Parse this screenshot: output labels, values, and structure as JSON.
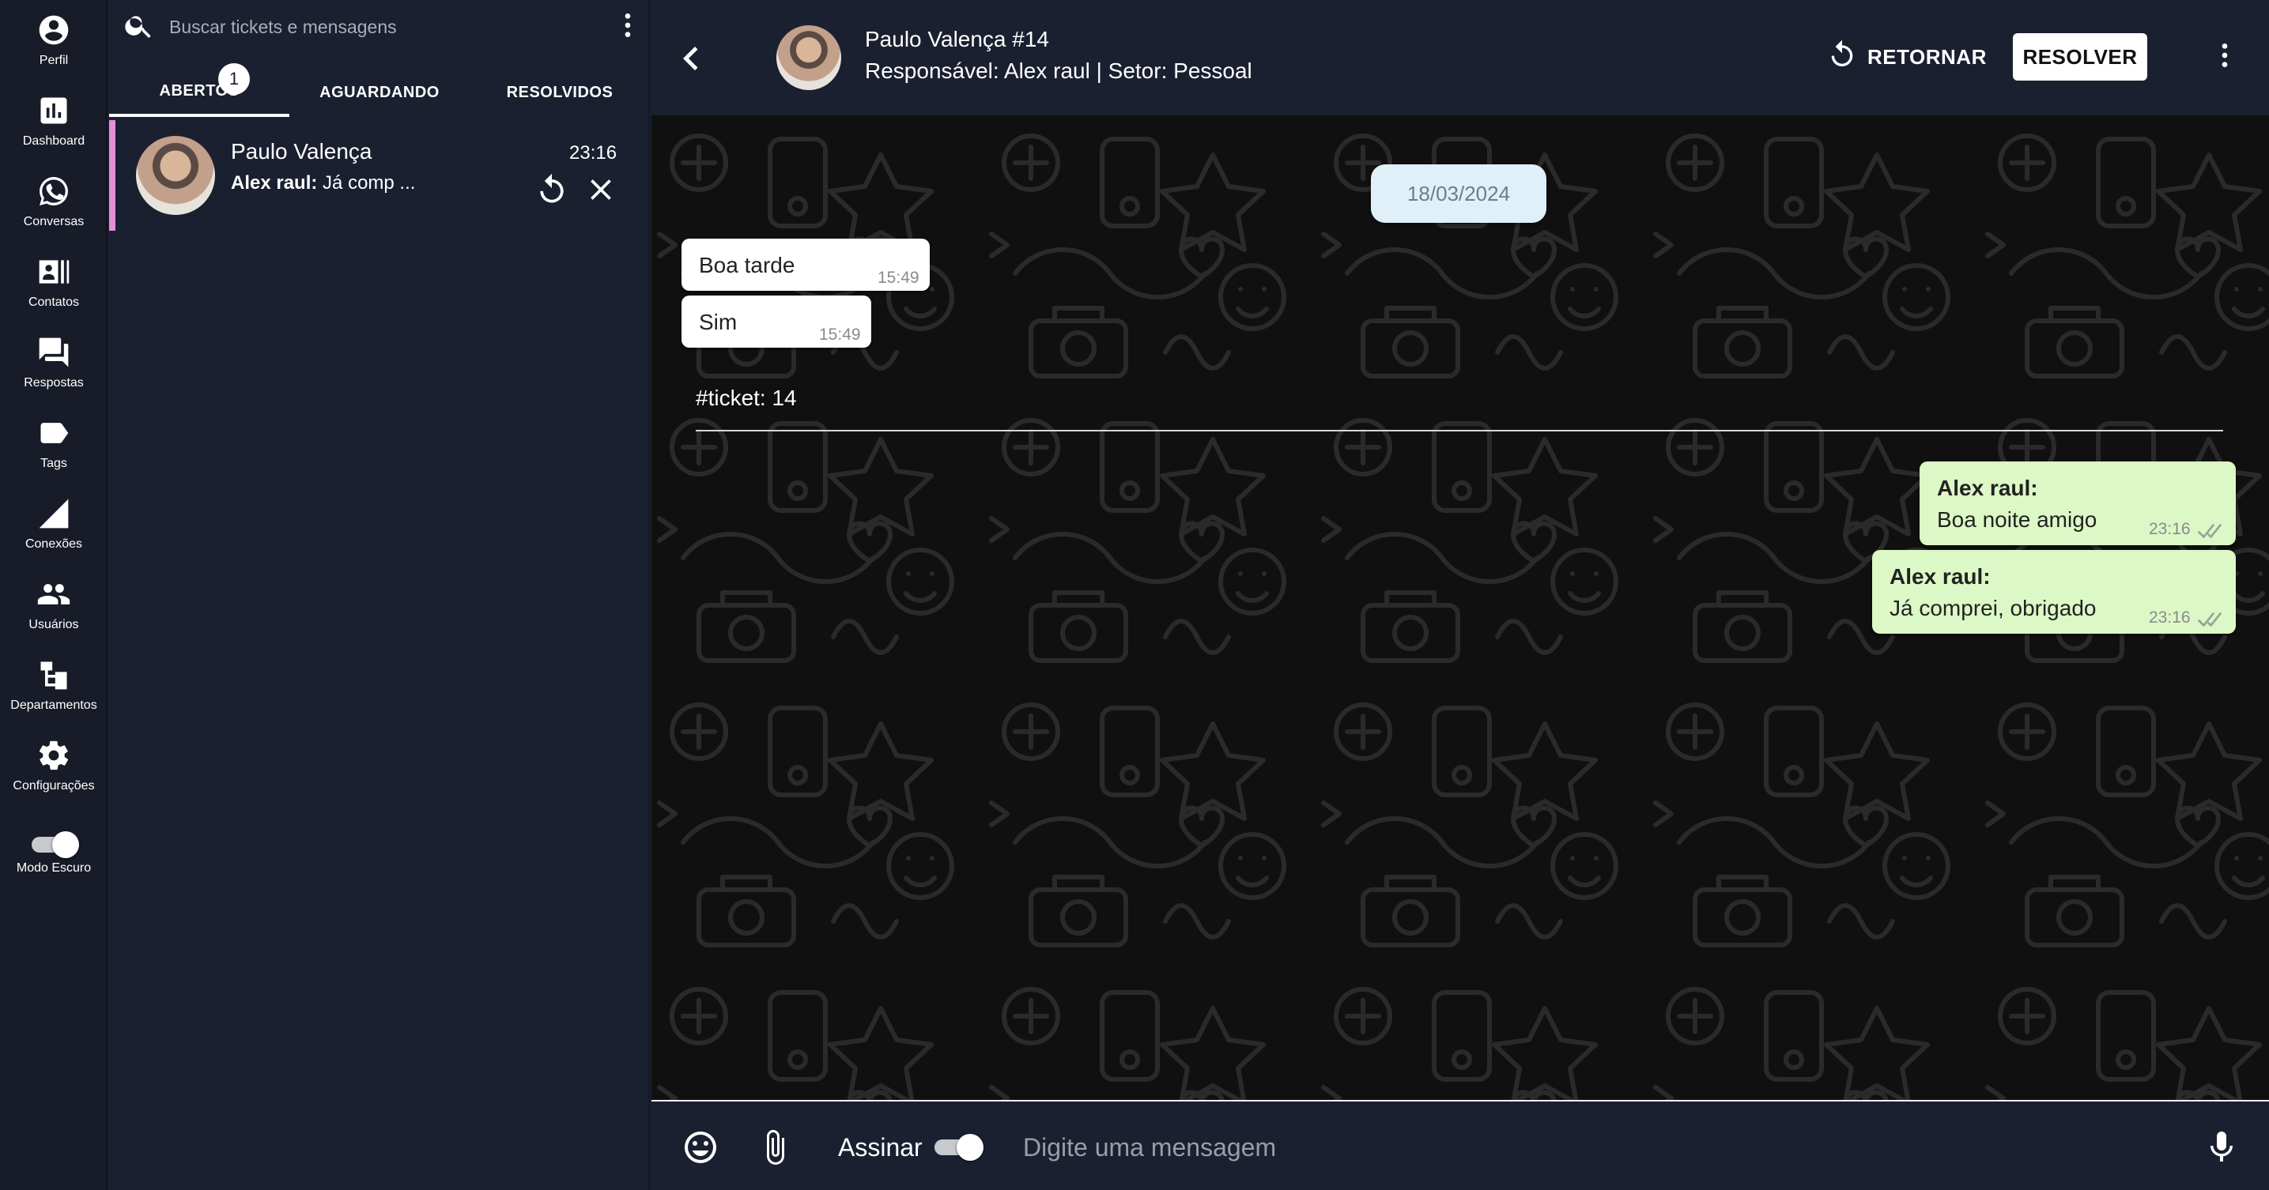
{
  "nav": {
    "items": [
      {
        "label": "Perfil",
        "icon": "account-circle-icon"
      },
      {
        "label": "Dashboard",
        "icon": "bar-chart-icon"
      },
      {
        "label": "Conversas",
        "icon": "whatsapp-icon"
      },
      {
        "label": "Contatos",
        "icon": "contacts-icon"
      },
      {
        "label": "Respostas",
        "icon": "forum-icon"
      },
      {
        "label": "Tags",
        "icon": "label-icon"
      },
      {
        "label": "Conexões",
        "icon": "signal-icon"
      },
      {
        "label": "Usuários",
        "icon": "people-icon"
      },
      {
        "label": "Departamentos",
        "icon": "sitemap-icon"
      },
      {
        "label": "Configurações",
        "icon": "gear-icon"
      }
    ],
    "dark_mode_label": "Modo Escuro",
    "dark_mode_on": true
  },
  "tickets": {
    "search_placeholder": "Buscar tickets e mensagens",
    "tabs": [
      {
        "label": "ABERTOS",
        "active": true
      },
      {
        "label": "AGUARDANDO",
        "active": false
      },
      {
        "label": "RESOLVIDOS",
        "active": false
      }
    ],
    "open_count": "1",
    "list": [
      {
        "name": "Paulo Valença",
        "preview_author": "Alex raul:",
        "preview_text": "Já comp ...",
        "time": "23:16",
        "accent": "#e48fd8"
      }
    ]
  },
  "chat": {
    "title": "Paulo Valença #14",
    "subtitle": "Responsável: Alex raul | Setor: Pessoal",
    "return_label": "RETORNAR",
    "resolve_label": "RESOLVER",
    "date": "18/03/2024",
    "messages_in": [
      {
        "text": "Boa tarde",
        "time": "15:49"
      },
      {
        "text": "Sim",
        "time": "15:49"
      }
    ],
    "ticket_marker": "#ticket: 14",
    "messages_out": [
      {
        "author": "Alex raul:",
        "text": "Boa noite amigo",
        "time": "23:16"
      },
      {
        "author": "Alex raul:",
        "text": "Já comprei, obrigado",
        "time": "23:16"
      }
    ],
    "colors": {
      "outgoing_bubble": "#dcf8c6",
      "incoming_bubble": "#ffffff",
      "date_chip": "#dff0f8"
    }
  },
  "composer": {
    "sign_label": "Assinar",
    "sign_on": true,
    "placeholder": "Digite uma mensagem"
  }
}
